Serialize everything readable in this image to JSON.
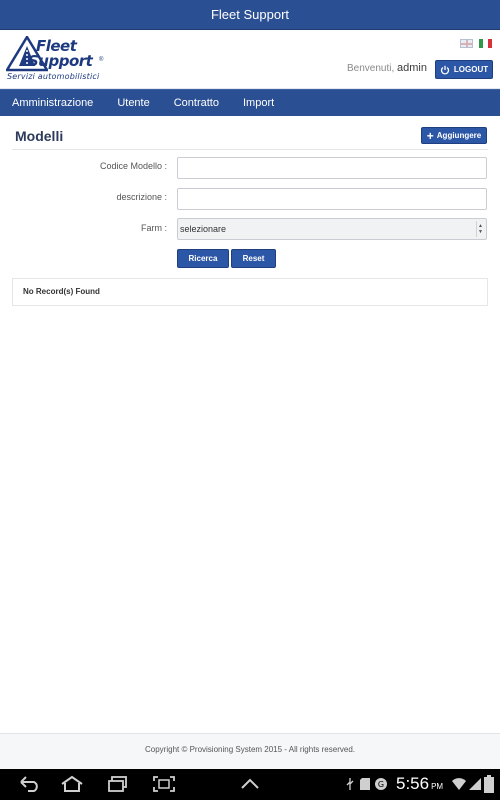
{
  "app": {
    "title": "Fleet Support"
  },
  "logo": {
    "line1": "Fleet",
    "line2": "Support",
    "reg": "®",
    "tagline": "Servizi automobilistici"
  },
  "header": {
    "welcome_text": "Benvenuti,",
    "username": "admin",
    "logout_label": "LOGOUT",
    "languages": [
      "English",
      "Italiano"
    ]
  },
  "nav": {
    "items": [
      {
        "label": "Amministrazione"
      },
      {
        "label": "Utente"
      },
      {
        "label": "Contratto"
      },
      {
        "label": "Import"
      }
    ]
  },
  "page": {
    "title": "Modelli",
    "add_label": "Aggiungere"
  },
  "form": {
    "codice_label": "Codice Modello :",
    "codice_value": "",
    "descrizione_label": "descrizione :",
    "descrizione_value": "",
    "farm_label": "Farm :",
    "farm_selected": "selezionare",
    "search_label": "Ricerca",
    "reset_label": "Reset"
  },
  "results": {
    "message": "No Record(s) Found"
  },
  "footer": {
    "text": "Copyright © Provisioning System 2015 - All rights reserved."
  },
  "system_bar": {
    "time": "5:56",
    "ampm": "PM"
  },
  "colors": {
    "primary": "#2b4f93",
    "button": "#2c56a6",
    "logo_blue": "#1d3a80"
  }
}
